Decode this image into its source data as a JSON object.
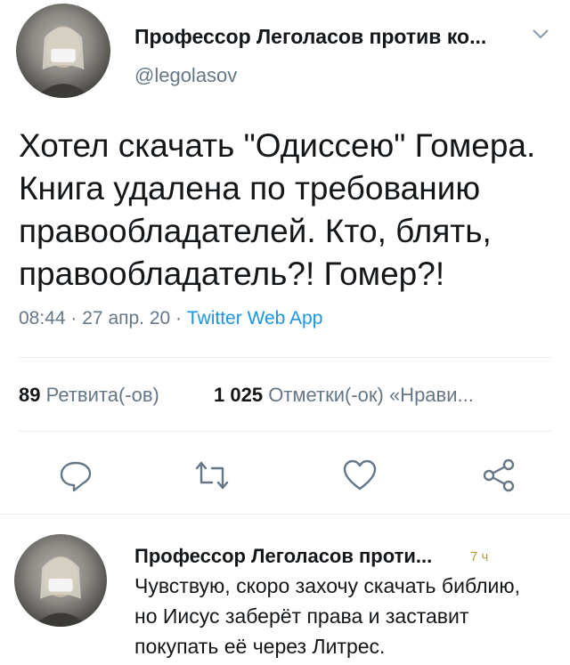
{
  "tweet": {
    "author_name": "Профессор Леголасов против ко...",
    "author_handle": "@legolasov",
    "text": "Хотел скачать \"Одиссею\" Гомера. Книга удалена по требованию правообладателей. Кто, блять, правообладатель?! Гомер?!",
    "time": "08:44",
    "date": "27 апр. 20",
    "separator": "·",
    "source": "Twitter Web App"
  },
  "stats": {
    "retweets_count": "89",
    "retweets_label": "Ретвита(-ов)",
    "likes_count": "1 025",
    "likes_label": "Отметки(-ок) «Нрави..."
  },
  "actions": {
    "icons": [
      "reply-icon",
      "retweet-icon",
      "like-icon",
      "share-icon"
    ]
  },
  "reply": {
    "author_name": "Профессор Леголасов проти...",
    "timestamp": "7 ч",
    "text": "Чувствую, скоро захочу скачать библию, но Иисус заберёт права и заставит покупать её через Литрес."
  },
  "colors": {
    "text": "#14171a",
    "secondary": "#657786",
    "link": "#1b95e0",
    "divider": "#e6ecf0"
  }
}
